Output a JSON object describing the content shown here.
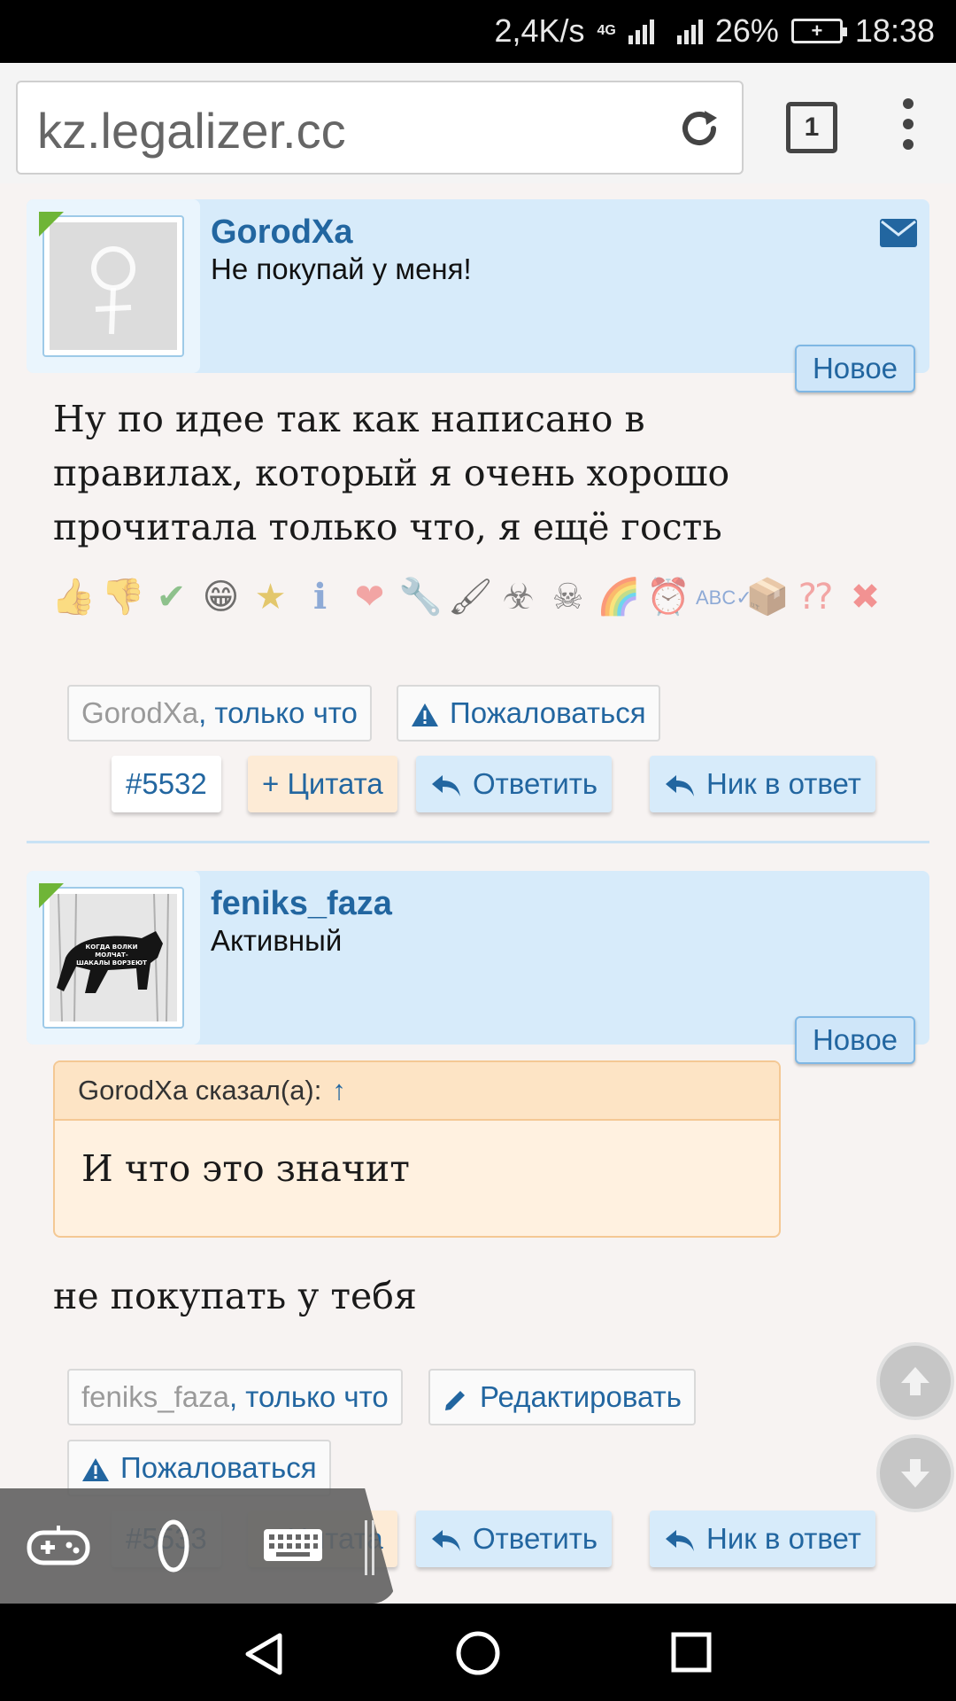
{
  "status_bar": {
    "network_speed": "2,4K/s",
    "network_type": "4G",
    "battery": "26%",
    "time": "18:38"
  },
  "browser": {
    "url": "kz.legalizer.cc",
    "tab_count": "1"
  },
  "posts": [
    {
      "username": "GorodXa",
      "user_title": "Не покупай у меня!",
      "badge": "Новое",
      "message": [
        "Ну по идее так как написано в",
        "правилах, который я очень хорошо",
        "прочитала только что, я ещё гость"
      ],
      "meta_user": "GorodXa",
      "meta_time": ", только что",
      "report_label": "Пожаловаться",
      "post_number": "#5532",
      "quote_label": "+ Цитата",
      "reply_label": "Ответить",
      "nick_reply_label": "Ник в ответ"
    },
    {
      "username": "feniks_faza",
      "user_title": "Активный",
      "badge": "Новое",
      "avatar_caption": [
        "КОГДА ВОЛКИ",
        "МОЛЧАТ-",
        "ШАКАЛЫ ВОРЗЕЮТ"
      ],
      "quote_author": "GorodXa сказал(а):",
      "quote_arrow": "↑",
      "quote_text": "И что это значит",
      "message": [
        "не покупать у тебя"
      ],
      "meta_user": "feniks_faza",
      "meta_time": ", только что",
      "edit_label": "Редактировать",
      "report_label": "Пожаловаться",
      "post_number": "#5533",
      "quote_label": "+ Цитата",
      "reply_label": "Ответить",
      "nick_reply_label": "Ник в ответ"
    }
  ],
  "reactions": [
    "thumbs-up",
    "thumbs-down",
    "check",
    "grin",
    "star-medal",
    "info",
    "heart",
    "wrench",
    "brush",
    "biohazard",
    "skull",
    "rainbow",
    "alarm-clock",
    "spellcheck",
    "box",
    "question",
    "cross"
  ],
  "colors": {
    "accent_blue": "#2266a0",
    "user_block_bg": "#d7ebfa",
    "quote_bg": "#fff1e0",
    "online_corner": "#6fb537"
  }
}
